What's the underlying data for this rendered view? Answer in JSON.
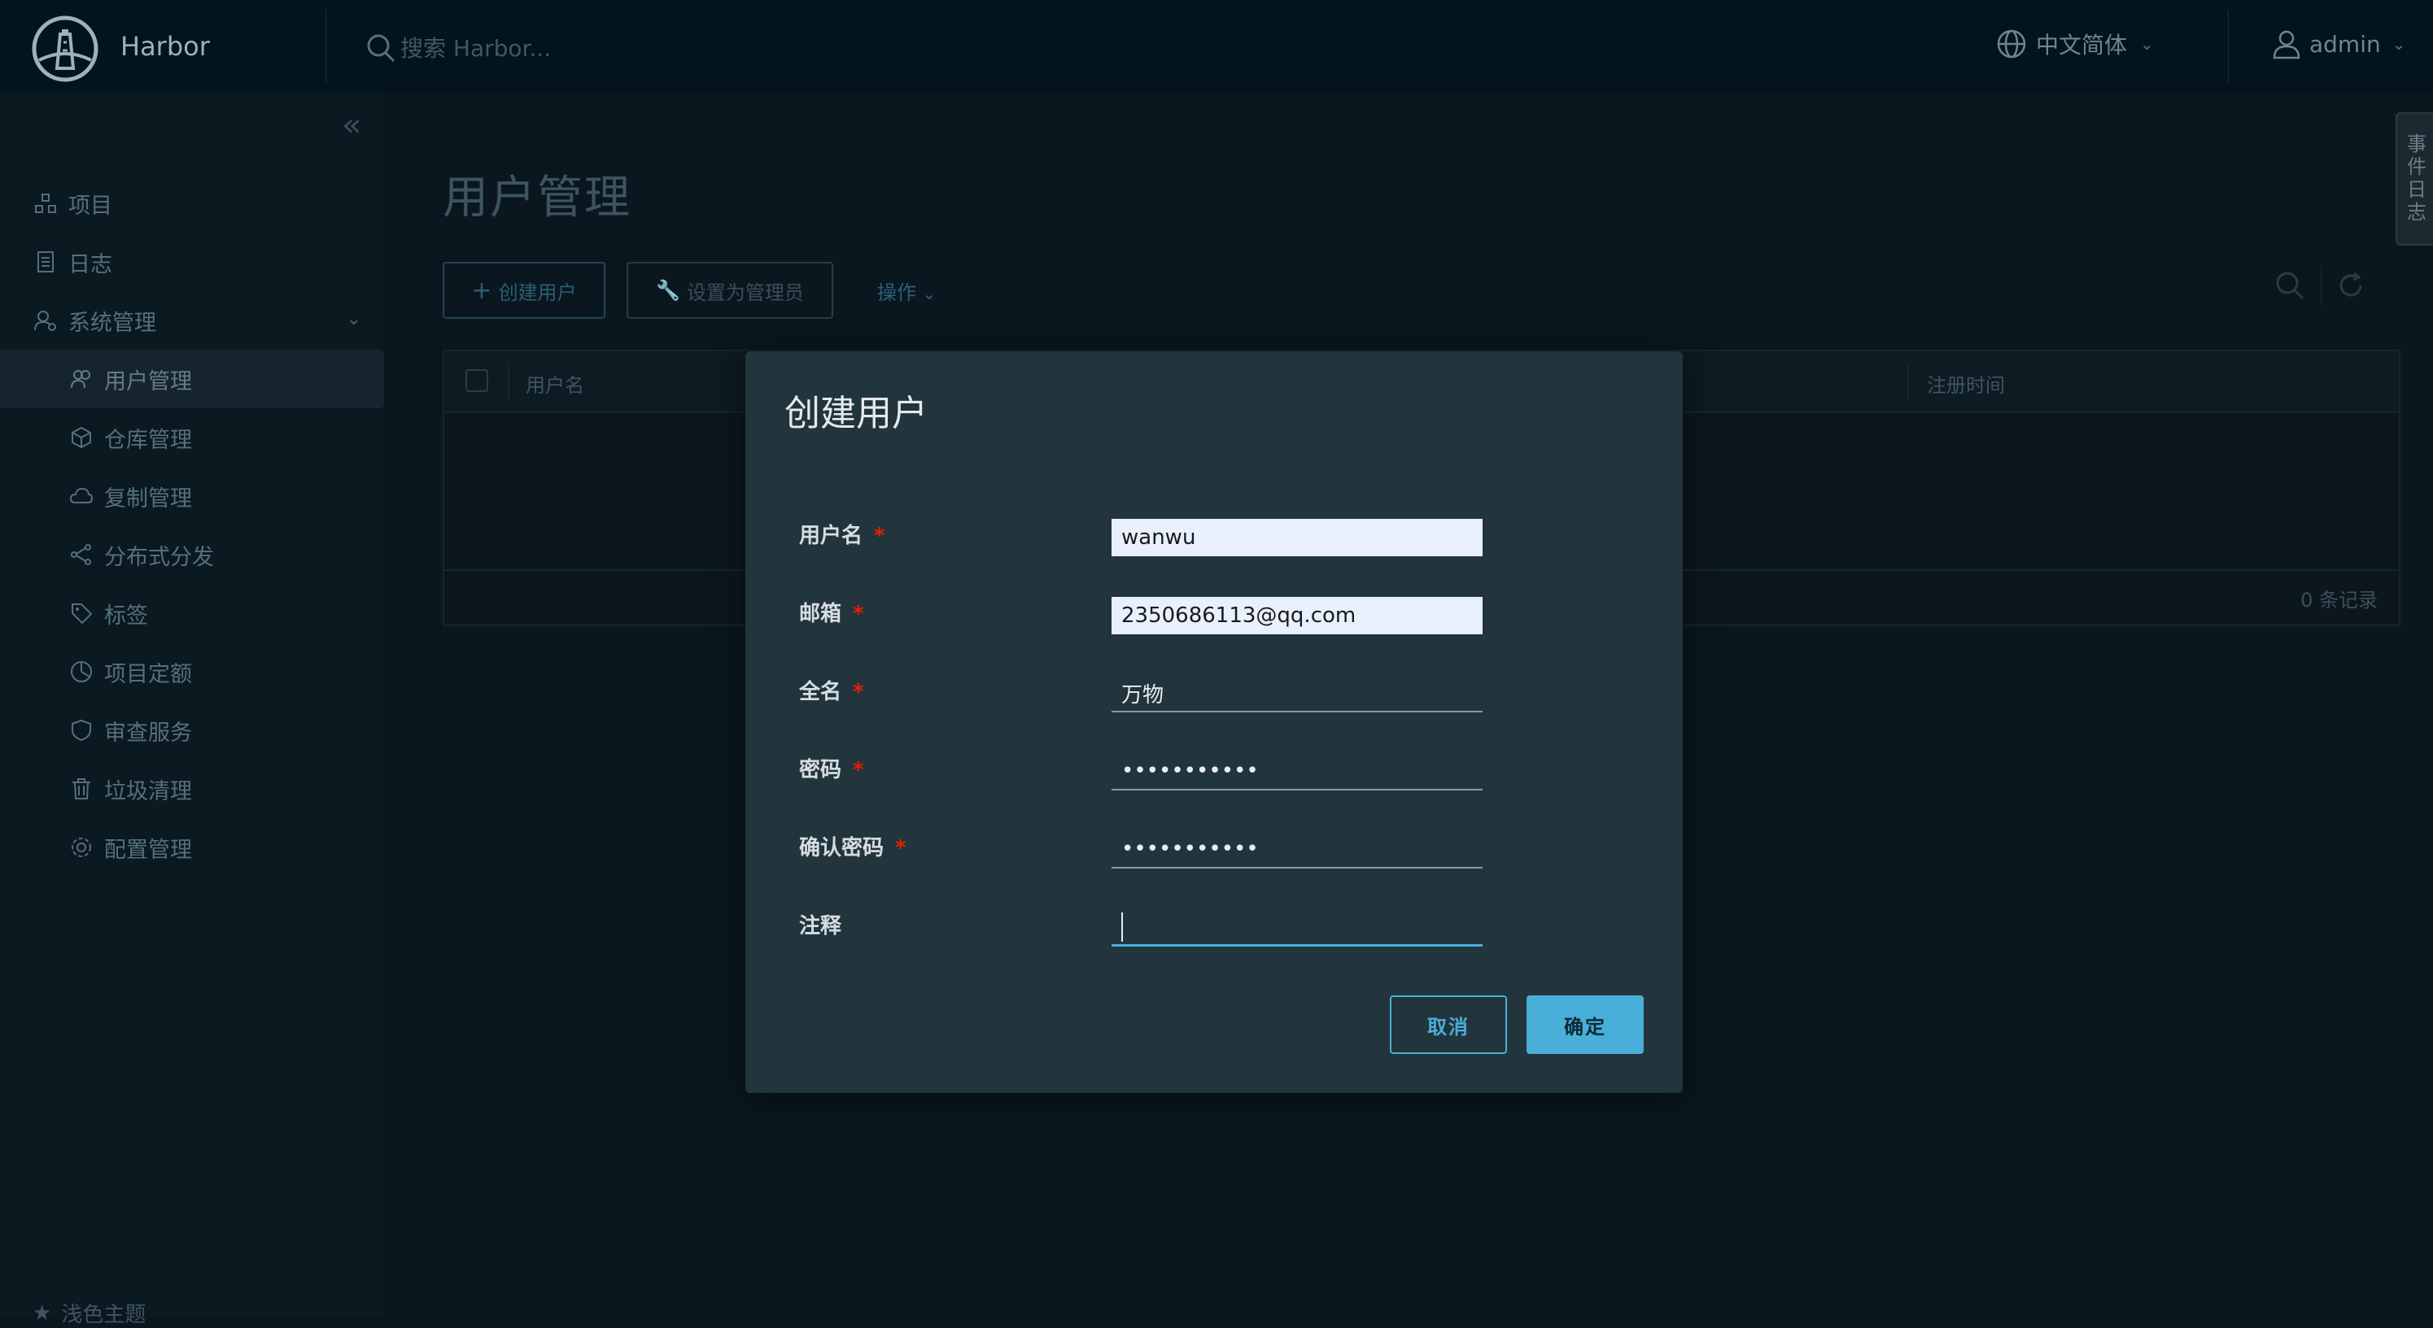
{
  "header": {
    "brand": "Harbor",
    "search_placeholder": "搜索 Harbor...",
    "language": "中文简体",
    "user": "admin"
  },
  "sidebar": {
    "items": [
      {
        "label": "项目",
        "icon": "projects-icon"
      },
      {
        "label": "日志",
        "icon": "logs-icon"
      },
      {
        "label": "系统管理",
        "icon": "admin-icon"
      },
      {
        "label": "用户管理",
        "icon": "users-icon"
      },
      {
        "label": "仓库管理",
        "icon": "registry-icon"
      },
      {
        "label": "复制管理",
        "icon": "replication-icon"
      },
      {
        "label": "分布式分发",
        "icon": "distribution-icon"
      },
      {
        "label": "标签",
        "icon": "tag-icon"
      },
      {
        "label": "项目定额",
        "icon": "quota-icon"
      },
      {
        "label": "审查服务",
        "icon": "shield-icon"
      },
      {
        "label": "垃圾清理",
        "icon": "trash-icon"
      },
      {
        "label": "配置管理",
        "icon": "gear-icon"
      }
    ],
    "bottom_item": "浅色主题"
  },
  "main": {
    "title": "用户管理",
    "create_user": "创建用户",
    "set_admin": "设置为管理员",
    "actions": "操作",
    "columns": [
      "用户名",
      "注册时间"
    ],
    "record_count": "0 条记录"
  },
  "right_tab": "事件日志",
  "modal": {
    "title": "创建用户",
    "fields": {
      "username": {
        "label": "用户名",
        "value": "wanwu"
      },
      "email": {
        "label": "邮箱",
        "value": "2350686113@qq.com"
      },
      "fullname": {
        "label": "全名",
        "value": "万物"
      },
      "password": {
        "label": "密码",
        "value": "•••••••••••"
      },
      "confirm": {
        "label": "确认密码",
        "value": "•••••••••••"
      },
      "comment": {
        "label": "注释",
        "value": ""
      }
    },
    "required_mark": "*",
    "cancel": "取消",
    "ok": "确定"
  },
  "colors": {
    "accent": "#49afd9",
    "required": "#e12200",
    "modal_bg": "#22343c",
    "header_bg": "#03141e"
  }
}
